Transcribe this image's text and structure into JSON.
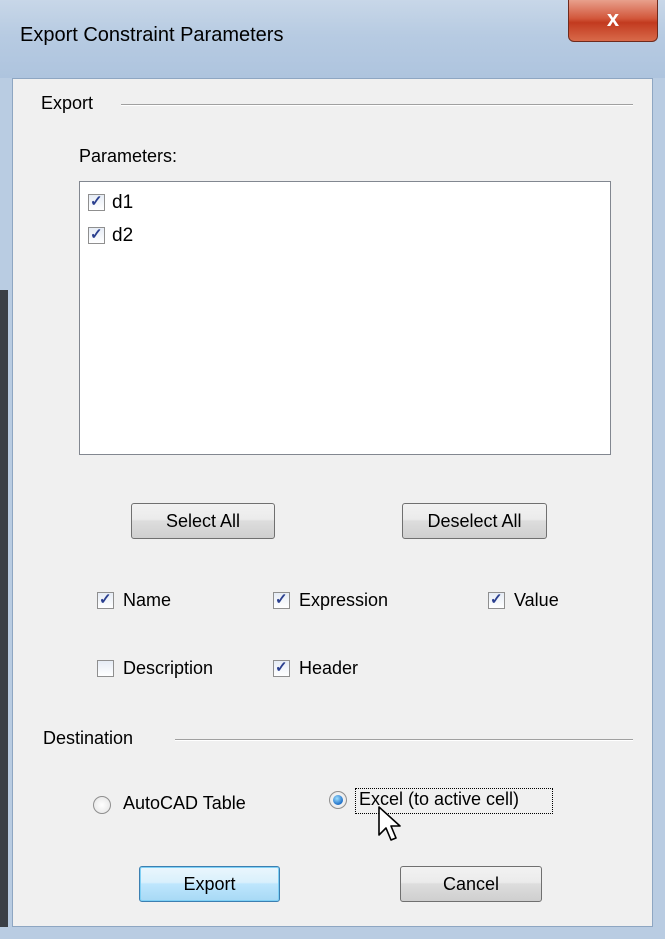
{
  "window": {
    "title": "Export Constraint Parameters",
    "close_glyph": "x"
  },
  "export_group": {
    "label": "Export",
    "parameters_label": "Parameters:",
    "parameters": [
      {
        "name": "d1",
        "checked": true
      },
      {
        "name": "d2",
        "checked": true
      }
    ],
    "select_all": "Select All",
    "deselect_all": "Deselect All",
    "options": {
      "name": {
        "label": "Name",
        "checked": true
      },
      "expression": {
        "label": "Expression",
        "checked": true
      },
      "value": {
        "label": "Value",
        "checked": true
      },
      "description": {
        "label": "Description",
        "checked": false
      },
      "header": {
        "label": "Header",
        "checked": true
      }
    }
  },
  "destination_group": {
    "label": "Destination",
    "autocad_table": {
      "label": "AutoCAD Table",
      "selected": false
    },
    "excel": {
      "label": "Excel (to active cell)",
      "selected": true
    }
  },
  "buttons": {
    "export": "Export",
    "cancel": "Cancel"
  },
  "colors": {
    "accent": "#3c7fb1",
    "close_button": "#c23a1f",
    "title_bar": "#b7cbe2"
  }
}
